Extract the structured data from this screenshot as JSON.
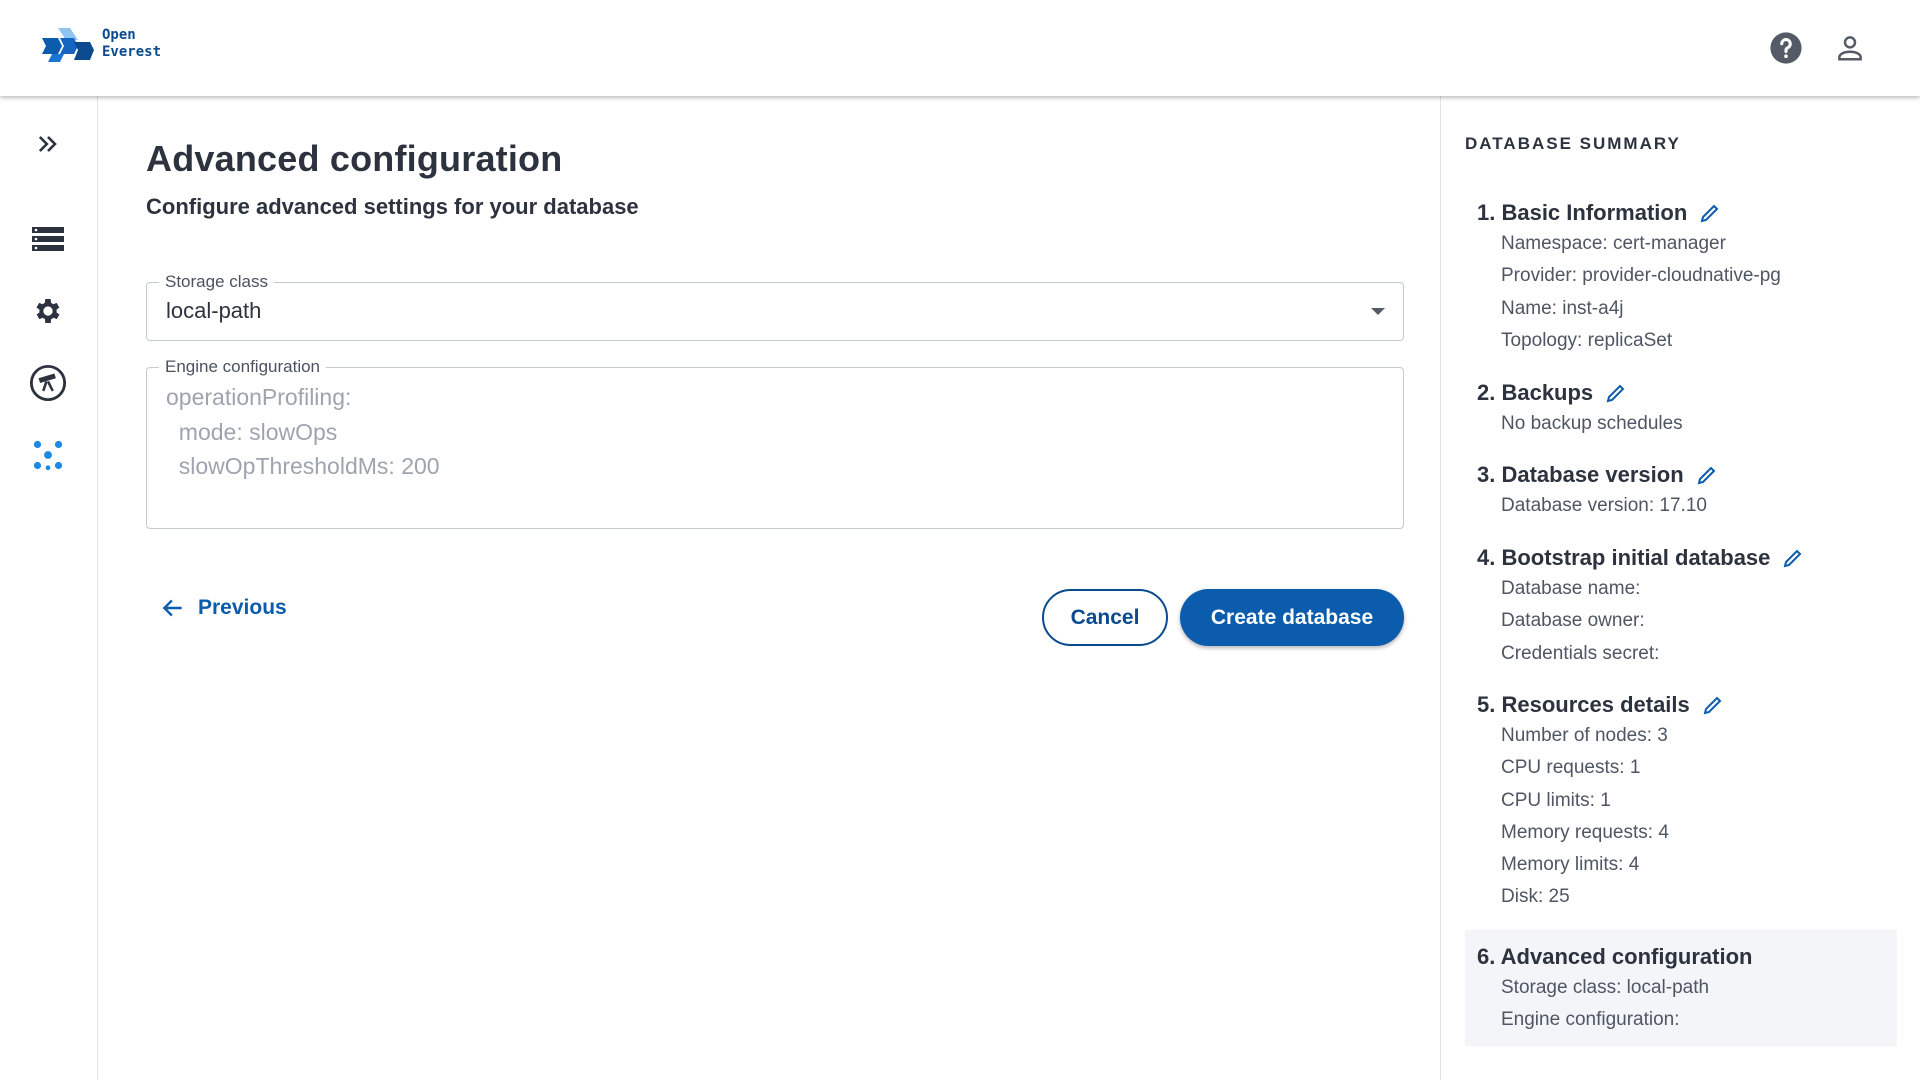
{
  "header": {
    "logo_line1": "Open",
    "logo_line2": "Everest"
  },
  "main": {
    "title": "Advanced configuration",
    "subtitle": "Configure advanced settings for your database",
    "storage_class": {
      "label": "Storage class",
      "value": "local-path"
    },
    "engine_config": {
      "label": "Engine configuration",
      "placeholder": "operationProfiling:\n  mode: slowOps\n  slowOpThresholdMs: 200"
    },
    "buttons": {
      "previous": "Previous",
      "cancel": "Cancel",
      "create": "Create database"
    }
  },
  "summary": {
    "title": "DATABASE SUMMARY",
    "sections": [
      {
        "title": "1. Basic Information",
        "lines": [
          "Namespace: cert-manager",
          "Provider: provider-cloudnative-pg",
          "Name: inst-a4j",
          "Topology: replicaSet"
        ]
      },
      {
        "title": "2. Backups",
        "lines": [
          "No backup schedules"
        ]
      },
      {
        "title": "3. Database version",
        "lines": [
          "Database version: 17.10"
        ]
      },
      {
        "title": "4. Bootstrap initial database",
        "lines": [
          "Database name:",
          "Database owner:",
          "Credentials secret:"
        ]
      },
      {
        "title": "5. Resources details",
        "lines": [
          "Number of nodes: 3",
          "CPU requests: 1",
          "CPU limits: 1",
          "Memory requests: 4",
          "Memory limits: 4",
          "Disk: 25"
        ]
      },
      {
        "title": "6. Advanced configuration",
        "lines": [
          "Storage class: local-path",
          "Engine configuration:"
        ]
      }
    ]
  },
  "colors": {
    "primary": "#0b5cad",
    "text": "#2c323e",
    "accent_icon": "#1e88e5"
  }
}
